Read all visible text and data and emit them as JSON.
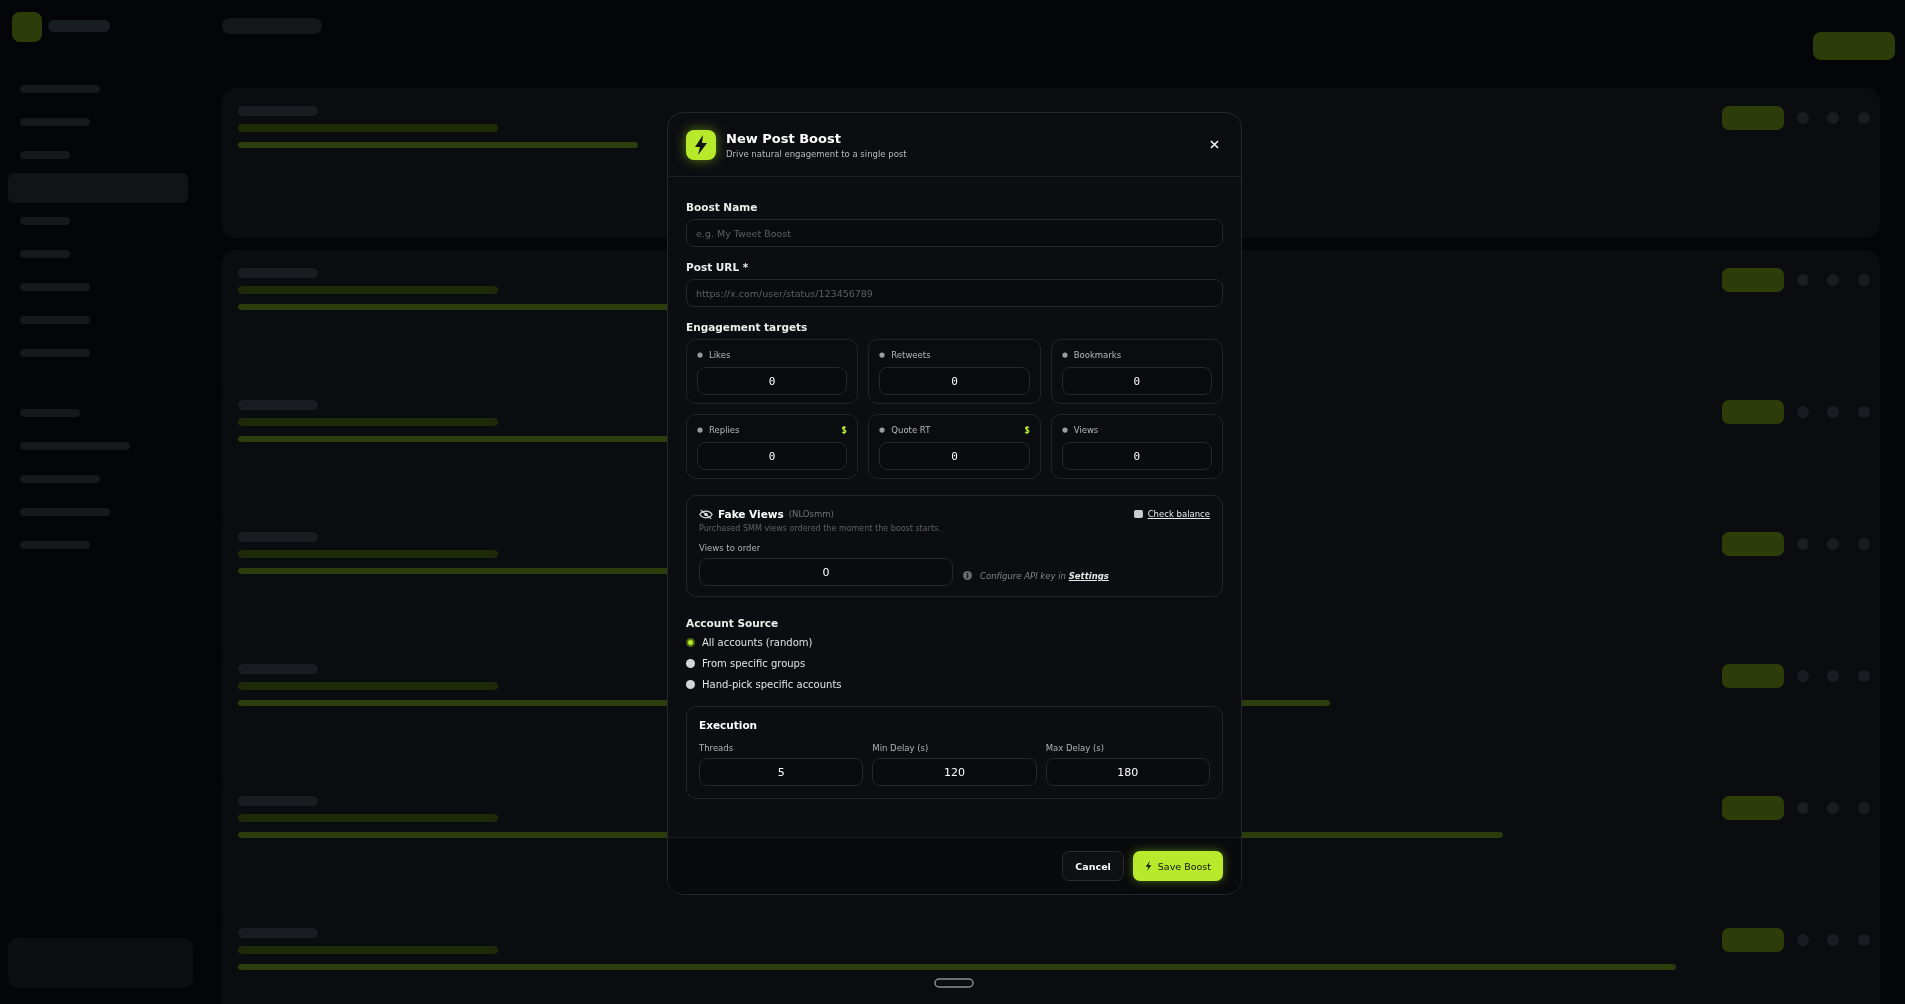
{
  "dialog": {
    "title": "New Post Boost",
    "subtitle": "Drive natural engagement to a single post"
  },
  "fields": [
    {
      "label": "Boost Name",
      "placeholder": "e.g. My Tweet Boost"
    },
    {
      "label": "Post URL *",
      "placeholder": "https://x.com/user/status/123456789"
    }
  ],
  "engagement": {
    "title": "Engagement targets",
    "targets": [
      {
        "label": "Likes",
        "value": "0",
        "paid": false
      },
      {
        "label": "Retweets",
        "value": "0",
        "paid": false
      },
      {
        "label": "Bookmarks",
        "value": "0",
        "paid": false
      },
      {
        "label": "Replies",
        "value": "0",
        "paid": true
      },
      {
        "label": "Quote RT",
        "value": "0",
        "paid": true
      },
      {
        "label": "Views",
        "value": "0",
        "paid": false
      }
    ]
  },
  "fake_views": {
    "title": "Fake Views",
    "provider": "(NLOsmm)",
    "description": "Purchased SMM views ordered the moment the boost starts.",
    "check_balance": "Check balance",
    "field_label": "Views to order",
    "value": "0",
    "hint": "Configure API key in",
    "hint_link": "Settings"
  },
  "account_source": {
    "title": "Account Source",
    "options": [
      {
        "label": "All accounts (random)",
        "selected": true
      },
      {
        "label": "From specific groups",
        "selected": false
      },
      {
        "label": "Hand-pick specific accounts",
        "selected": false
      }
    ]
  },
  "execution": {
    "title": "Execution",
    "fields": [
      {
        "label": "Threads",
        "value": "5"
      },
      {
        "label": "Min Delay (s)",
        "value": "120"
      },
      {
        "label": "Max Delay (s)",
        "value": "180"
      }
    ]
  },
  "buttons": {
    "cancel": "Cancel",
    "save": "Save Boost"
  }
}
